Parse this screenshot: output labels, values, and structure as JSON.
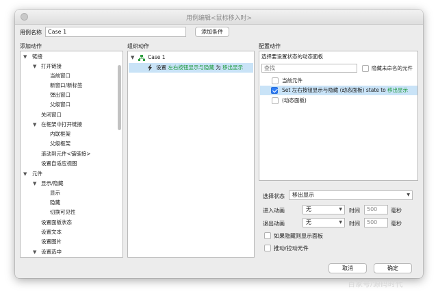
{
  "window": {
    "title": "用例编辑<鼠标移入时>"
  },
  "case_name": {
    "label": "用例名称",
    "value": "Case 1",
    "add_condition_label": "添加条件"
  },
  "add_actions": {
    "header": "添加动作",
    "tree": [
      {
        "label": "链接",
        "arrow": "▼"
      },
      {
        "label": "打开链接",
        "arrow": "▼"
      },
      {
        "label": "当前窗口"
      },
      {
        "label": "新窗口/新标签"
      },
      {
        "label": "弹出窗口"
      },
      {
        "label": "父级窗口"
      },
      {
        "label": "关闭窗口"
      },
      {
        "label": "在框架中打开链接",
        "arrow": "▼"
      },
      {
        "label": "内联框架"
      },
      {
        "label": "父级框架"
      },
      {
        "label": "滚动到元件<锚链接>"
      },
      {
        "label": "设置自适应视图"
      },
      {
        "label": "元件",
        "arrow": "▼"
      },
      {
        "label": "显示/隐藏",
        "arrow": "▼"
      },
      {
        "label": "显示"
      },
      {
        "label": "隐藏"
      },
      {
        "label": "切换可见性"
      },
      {
        "label": "设置面板状态"
      },
      {
        "label": "设置文本"
      },
      {
        "label": "设置图片"
      },
      {
        "label": "设置选中",
        "arrow": "▼"
      }
    ]
  },
  "organize_actions": {
    "header": "组织动作",
    "case_label": "Case 1",
    "case_arrow": "▼",
    "action": {
      "prefix": "设置",
      "target": "左右按钮显示与隐藏",
      "connector": "为",
      "state": "移出显示"
    }
  },
  "configure_action": {
    "header": "配置动作",
    "subheader": "选择要设置状态的动态面板",
    "search_placeholder": "查找",
    "hide_unnamed_label": "隐藏未命名的元件",
    "items": [
      {
        "label": "当前元件",
        "checked": false
      },
      {
        "prefix": "Set",
        "name": "左右按钮显示与隐藏 (动态面板)",
        "connector": "state to",
        "state": "移出显示",
        "checked": true
      },
      {
        "label": "(动态面板)",
        "checked": false
      }
    ],
    "select_state_label": "选择状态",
    "select_state_value": "移出显示",
    "enter_animation_label": "进入动画",
    "enter_animation_value": "无",
    "exit_animation_label": "退出动画",
    "exit_animation_value": "无",
    "time_label": "时间",
    "time_value_enter": "500",
    "time_value_exit": "500",
    "ms_label": "毫秒",
    "show_if_hidden_label": "如果隐藏则显示面板",
    "push_pull_label": "推动/拉动元件"
  },
  "footer": {
    "cancel_label": "取消",
    "ok_label": "确定"
  },
  "watermark": "百家号/源码时代",
  "colors": {
    "selection": "#c9e3f7",
    "accent_green": "#1d9a3c",
    "checkbox_blue": "#2f7df6"
  }
}
